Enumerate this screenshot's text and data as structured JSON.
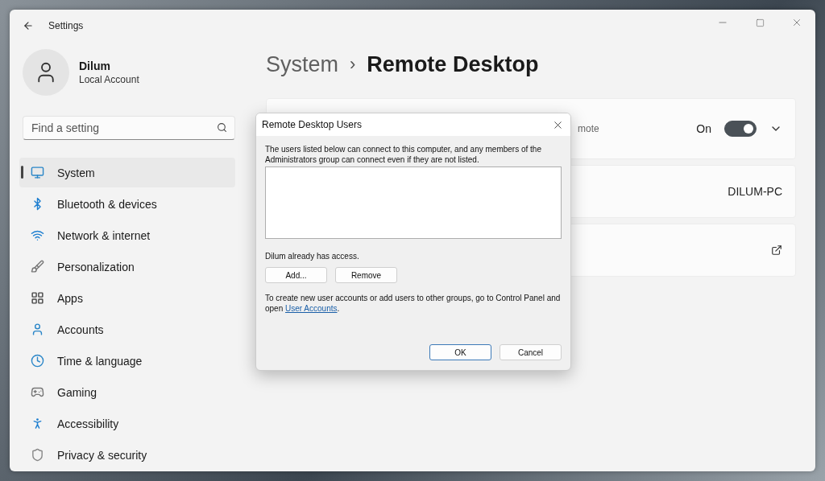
{
  "window": {
    "title": "Settings"
  },
  "user": {
    "name": "Dilum",
    "account": "Local Account"
  },
  "search": {
    "placeholder": "Find a setting"
  },
  "sidebar": {
    "items": [
      {
        "label": "System",
        "selected": true
      },
      {
        "label": "Bluetooth & devices",
        "selected": false
      },
      {
        "label": "Network & internet",
        "selected": false
      },
      {
        "label": "Personalization",
        "selected": false
      },
      {
        "label": "Apps",
        "selected": false
      },
      {
        "label": "Accounts",
        "selected": false
      },
      {
        "label": "Time & language",
        "selected": false
      },
      {
        "label": "Gaming",
        "selected": false
      },
      {
        "label": "Accessibility",
        "selected": false
      },
      {
        "label": "Privacy & security",
        "selected": false
      }
    ]
  },
  "breadcrumb": {
    "parent": "System",
    "separator": "›",
    "current": "Remote Desktop"
  },
  "cards": [
    {
      "kind": "toggle",
      "description": "mote",
      "state_label": "On",
      "on": true
    },
    {
      "kind": "value",
      "value": "DILUM-PC"
    },
    {
      "kind": "link"
    }
  ],
  "dialog": {
    "title": "Remote Desktop Users",
    "intro": "The users listed below can connect to this computer, and any members of the Administrators group can connect even if they are not listed.",
    "status": "Dilum already has access.",
    "buttons": [
      "Add...",
      "Remove"
    ],
    "note": "To create new user accounts or add users to other groups, go to Control Panel and open",
    "link": "User Accounts",
    "note_end": ".",
    "footer_buttons": [
      {
        "label": "OK",
        "default": true
      },
      {
        "label": "Cancel",
        "default": false
      }
    ]
  }
}
